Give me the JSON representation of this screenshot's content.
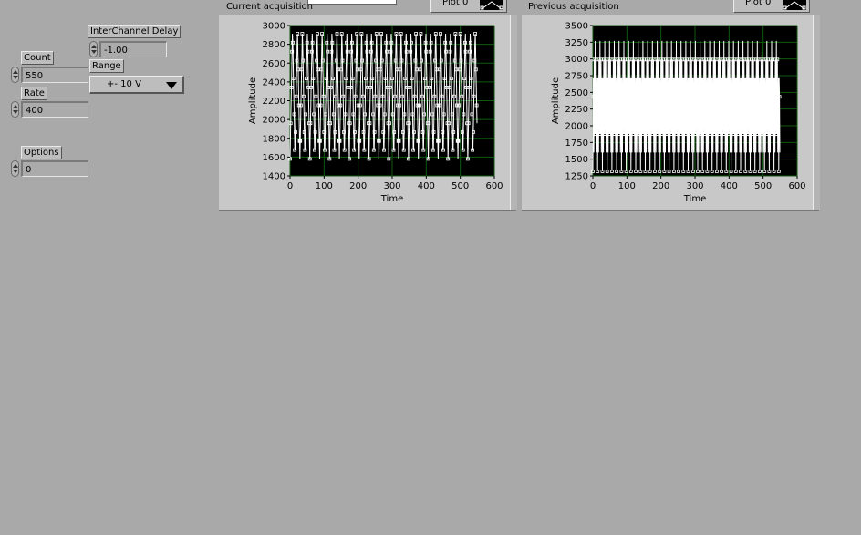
{
  "controls": {
    "count": {
      "label": "Count",
      "value": "550"
    },
    "rate": {
      "label": "Rate",
      "value": "400"
    },
    "options": {
      "label": "Options",
      "value": "0"
    },
    "interchannel_delay": {
      "label": "InterChannel Delay",
      "value": "-1.00"
    },
    "range": {
      "label": "Range",
      "value": "+- 10 V"
    }
  },
  "graphs": [
    {
      "title": "Current acquisition",
      "legend": "Plot 0",
      "xlabel": "Time",
      "ylabel": "Amplitude",
      "xlim": [
        0,
        600
      ],
      "ylim": [
        1400,
        3000
      ],
      "x_ticks": [
        "0",
        "100",
        "200",
        "300",
        "400",
        "500",
        "600"
      ],
      "y_ticks": [
        "3000",
        "2800",
        "2600",
        "2400",
        "2200",
        "2000",
        "1800",
        "1600",
        "1400"
      ]
    },
    {
      "title": "Previous acquisition",
      "legend": "Plot 0",
      "xlabel": "Time",
      "ylabel": "Amplitude",
      "xlim": [
        0,
        600
      ],
      "ylim": [
        1250,
        3500
      ],
      "x_ticks": [
        "0",
        "100",
        "200",
        "300",
        "400",
        "500",
        "600"
      ],
      "y_ticks": [
        "3500",
        "3250",
        "3000",
        "2750",
        "2500",
        "2250",
        "2000",
        "1750",
        "1500",
        "1250"
      ]
    }
  ],
  "chart_data": [
    {
      "type": "line",
      "title": "Current acquisition",
      "xlabel": "Time",
      "ylabel": "Amplitude",
      "xlim": [
        0,
        600
      ],
      "ylim": [
        1400,
        3000
      ],
      "grid": true,
      "series": [
        {
          "name": "Plot 0",
          "x_range": [
            0,
            549
          ],
          "points": 550,
          "min": 1580,
          "max": 2960,
          "period": 14.5
        }
      ]
    },
    {
      "type": "line",
      "title": "Previous acquisition",
      "xlabel": "Time",
      "ylabel": "Amplitude",
      "xlim": [
        0,
        600
      ],
      "ylim": [
        1250,
        3500
      ],
      "grid": true,
      "series": [
        {
          "name": "Plot 0",
          "x_range": [
            0,
            549
          ],
          "points": 550,
          "min": 1320,
          "max": 3270,
          "period": 2.8
        }
      ]
    }
  ]
}
